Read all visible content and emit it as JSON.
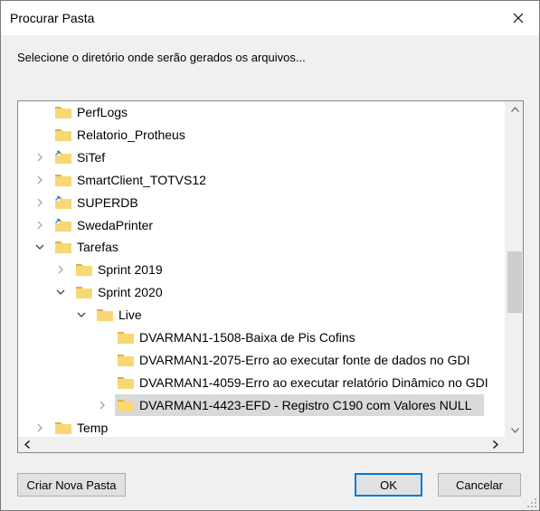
{
  "dialog": {
    "title": "Procurar Pasta",
    "description": "Selecione o diretório onde serão gerados os arquivos..."
  },
  "tree": {
    "items": [
      {
        "label": "PerfLogs",
        "expander": "none",
        "icon": "folder"
      },
      {
        "label": "Relatorio_Protheus",
        "expander": "none",
        "icon": "folder"
      },
      {
        "label": "SiTef",
        "expander": "collapsed",
        "icon": "folder-shared"
      },
      {
        "label": "SmartClient_TOTVS12",
        "expander": "collapsed",
        "icon": "folder"
      },
      {
        "label": "SUPERDB",
        "expander": "collapsed",
        "icon": "folder-shared"
      },
      {
        "label": "SwedaPrinter",
        "expander": "collapsed",
        "icon": "folder-shared"
      },
      {
        "label": "Tarefas",
        "expander": "expanded",
        "icon": "folder"
      },
      {
        "label": "Sprint 2019",
        "expander": "collapsed",
        "icon": "folder"
      },
      {
        "label": "Sprint 2020",
        "expander": "expanded",
        "icon": "folder"
      },
      {
        "label": "Live",
        "expander": "expanded",
        "icon": "folder"
      },
      {
        "label": "DVARMAN1-1508-Baixa de Pis Cofins",
        "expander": "none",
        "icon": "folder"
      },
      {
        "label": "DVARMAN1-2075-Erro ao executar fonte de dados no GDI",
        "expander": "none",
        "icon": "folder"
      },
      {
        "label": "DVARMAN1-4059-Erro ao executar relatório Dinâmico no GDI",
        "expander": "none",
        "icon": "folder"
      },
      {
        "label": "DVARMAN1-4423-EFD - Registro C190 com Valores NULL",
        "expander": "collapsed",
        "icon": "folder",
        "selected": true
      },
      {
        "label": "Temp",
        "expander": "collapsed",
        "icon": "folder"
      }
    ],
    "scroll": {
      "vertical_position": 0.55,
      "vertical_visible": 0.2
    }
  },
  "buttons": {
    "new_folder": "Criar Nova Pasta",
    "ok": "OK",
    "cancel": "Cancelar"
  },
  "colors": {
    "selection": "#d9d9d9",
    "default_button_border": "#0078d7",
    "folder_body": "#f8d775",
    "folder_tab": "#dcb04b",
    "shared_overlay": "#2f8fd6"
  }
}
